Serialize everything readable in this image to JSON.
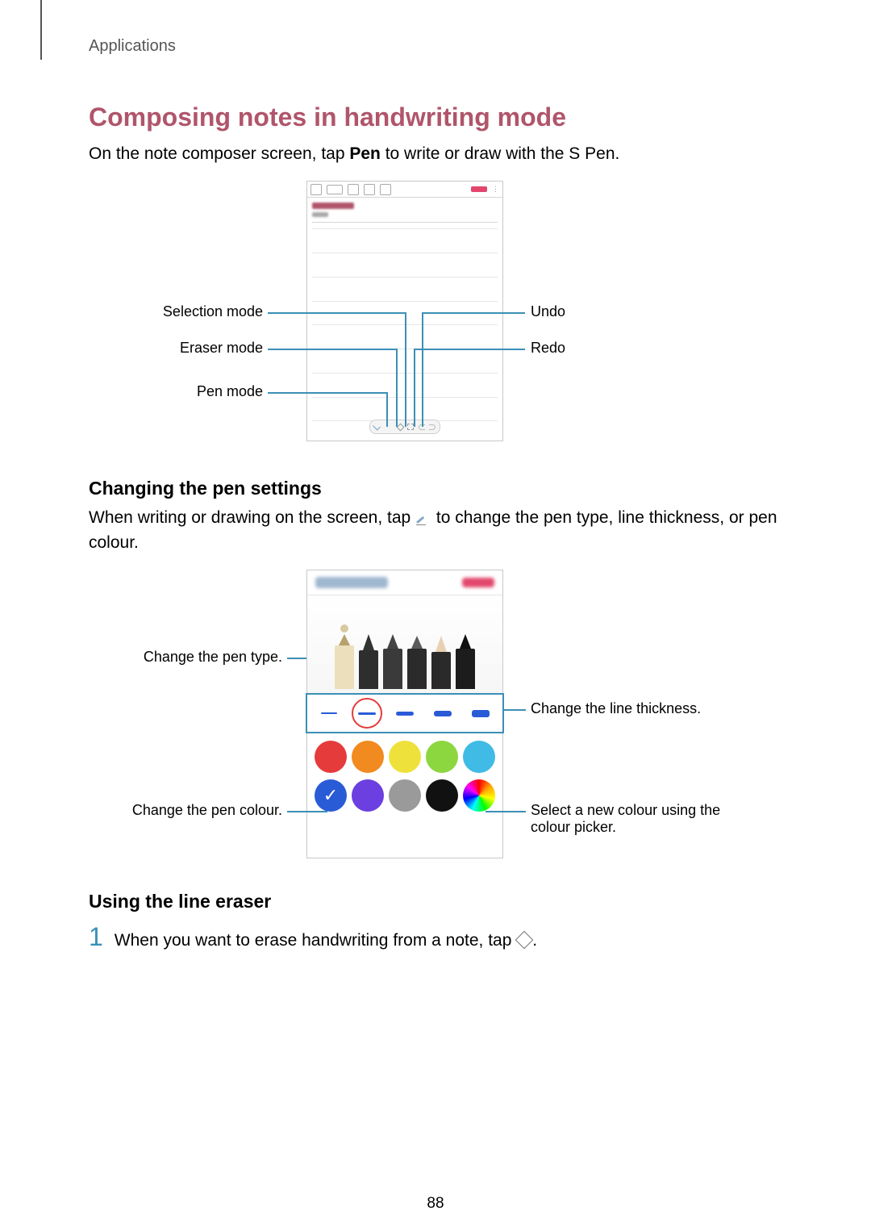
{
  "header": {
    "section": "Applications"
  },
  "h1": "Composing notes in handwriting mode",
  "intro_pre": "On the note composer screen, tap ",
  "intro_bold": "Pen",
  "intro_post": " to write or draw with the S Pen.",
  "callouts1": {
    "selection_mode": "Selection mode",
    "eraser_mode": "Eraser mode",
    "pen_mode": "Pen mode",
    "undo": "Undo",
    "redo": "Redo"
  },
  "h2a": "Changing the pen settings",
  "para2_pre": "When writing or drawing on the screen, tap ",
  "para2_post": " to change the pen type, line thickness, or pen colour.",
  "callouts2": {
    "pen_type": "Change the pen type.",
    "pen_colour": "Change the pen colour.",
    "line_thickness": "Change the line thickness.",
    "colour_picker": "Select a new colour using the colour picker."
  },
  "h2b": "Using the line eraser",
  "step1_num": "1",
  "step1_pre": "When you want to erase handwriting from a note, tap ",
  "step1_post": ".",
  "page_num": "88",
  "colors": {
    "row1": [
      "#e63b3b",
      "#f18a1f",
      "#efe13b",
      "#8cd63f",
      "#3fbbe6"
    ],
    "row2": [
      "#2a5bd7",
      "#6b3fe0",
      "#9a9a9a",
      "#111111",
      "rainbow"
    ]
  }
}
